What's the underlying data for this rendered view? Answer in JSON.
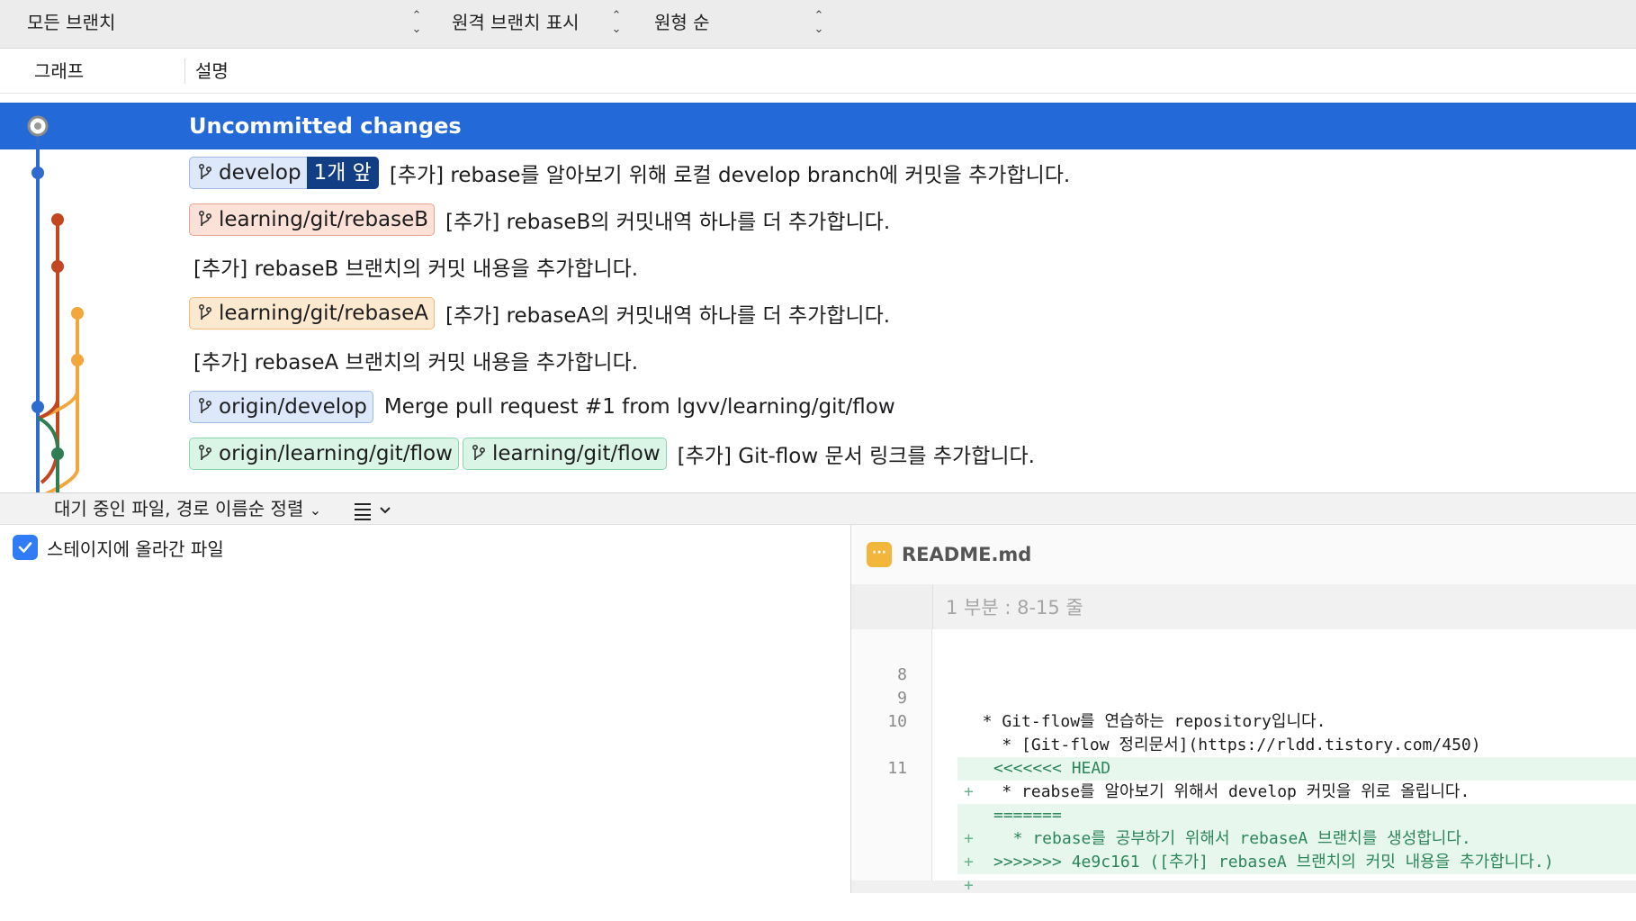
{
  "filters": {
    "branches": "모든 브랜치",
    "remote": "원격 브랜치 표시",
    "order": "원형 순",
    "arrow_up": "⌃",
    "arrow_down": "⌄"
  },
  "columns": {
    "graph": "그래프",
    "description": "설명"
  },
  "commits": [
    {
      "message": "Uncommitted changes",
      "selected": true
    },
    {
      "tags": [
        {
          "label": "develop",
          "color": "blue",
          "ahead": "1개 앞"
        }
      ],
      "message": "[추가] rebase를 알아보기 위해 로컬 develop branch에 커밋을 추가합니다."
    },
    {
      "tags": [
        {
          "label": "learning/git/rebaseB",
          "color": "red"
        }
      ],
      "message": "[추가] rebaseB의 커밋내역 하나를 더 추가합니다."
    },
    {
      "message": "[추가] rebaseB 브랜치의 커밋 내용을 추가합니다."
    },
    {
      "tags": [
        {
          "label": "learning/git/rebaseA",
          "color": "orange"
        }
      ],
      "message": "[추가] rebaseA의 커밋내역 하나를 더 추가합니다."
    },
    {
      "message": "[추가] rebaseA 브랜치의 커밋 내용을 추가합니다."
    },
    {
      "tags": [
        {
          "label": "origin/develop",
          "color": "blue"
        }
      ],
      "message": "Merge pull request #1 from lgvv/learning/git/flow"
    },
    {
      "tags": [
        {
          "label": "origin/learning/git/flow",
          "color": "green"
        },
        {
          "label": "learning/git/flow",
          "color": "green"
        }
      ],
      "message": "[추가] Git-flow 문서 링크를 추가합니다."
    }
  ],
  "colors": {
    "selection": "#2469d8",
    "develop_line": "#2e6bd0",
    "rebaseB_line": "#c2461f",
    "rebaseA_line": "#f3a63b",
    "flow_line": "#2f7d52"
  },
  "stage_bar": {
    "sort_label": "대기 중인 파일, 경로 이름순 정렬",
    "list_icon": "list-icon"
  },
  "file_panel": {
    "staged_label": "스테이지에 올라간 파일",
    "staged_checked": true
  },
  "diff": {
    "file_name": "README.md",
    "file_icon": "···",
    "hunk_title": "1 부분 : 8-15 줄",
    "lines": [
      {
        "num": "8",
        "text": "",
        "added": false
      },
      {
        "num": "9",
        "text": "  * Git-flow를 연습하는 repository입니다.",
        "added": false
      },
      {
        "num": "10",
        "text": "    * [Git-flow 정리문서](https://rldd.tistory.com/450)",
        "added": false
      },
      {
        "num": "",
        "text": "<<<<<<< HEAD",
        "added": true
      },
      {
        "num": "11",
        "text": "    * reabse를 알아보기 위해서 develop 커밋을 위로 올립니다.",
        "added": false
      },
      {
        "num": "",
        "text": "=======",
        "added": true
      },
      {
        "num": "",
        "text": "  * rebase를 공부하기 위해서 rebaseA 브랜치를 생성합니다.",
        "added": true
      },
      {
        "num": "",
        "text": ">>>>>>> 4e9c161 ([추가] rebaseA 브랜치의 커밋 내용을 추가합니다.)",
        "added": true
      }
    ],
    "plus": "+"
  }
}
